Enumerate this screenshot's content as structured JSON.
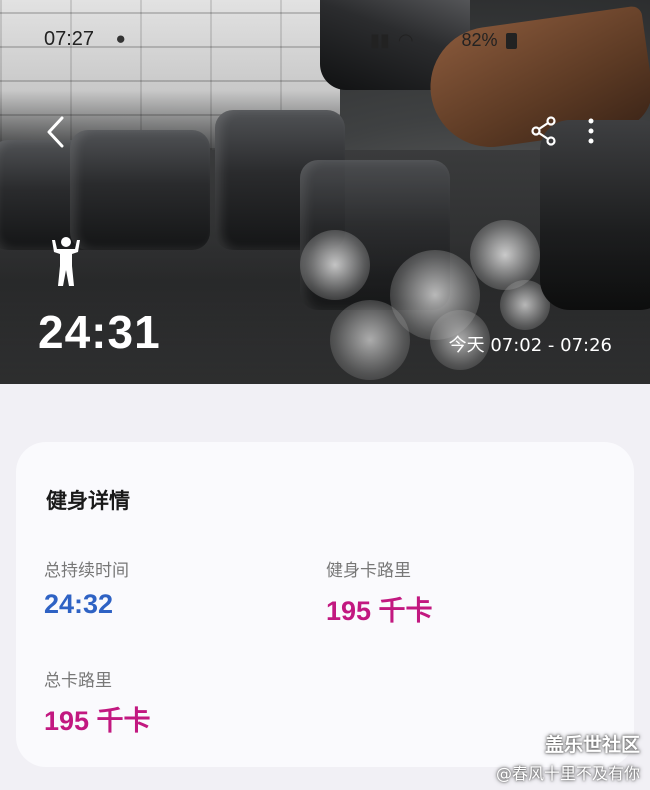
{
  "status_bar": {
    "time": "07:27",
    "battery": "82%"
  },
  "hero": {
    "duration": "24:31",
    "time_range": "今天 07:02 - 07:26"
  },
  "card": {
    "title": "健身详情",
    "metrics": [
      {
        "label": "总持续时间",
        "value": "24:32",
        "color": "#2e62c4"
      },
      {
        "label": "健身卡路里",
        "value": "195 千卡",
        "color": "#c21880"
      },
      {
        "label": "总卡路里",
        "value": "195 千卡",
        "color": "#c21880"
      }
    ]
  },
  "watermark": {
    "logo": "盖乐世社区",
    "user": "@春风十里不及有你"
  },
  "icons": [
    "back-icon",
    "share-icon",
    "more-icon",
    "workout-icon"
  ]
}
